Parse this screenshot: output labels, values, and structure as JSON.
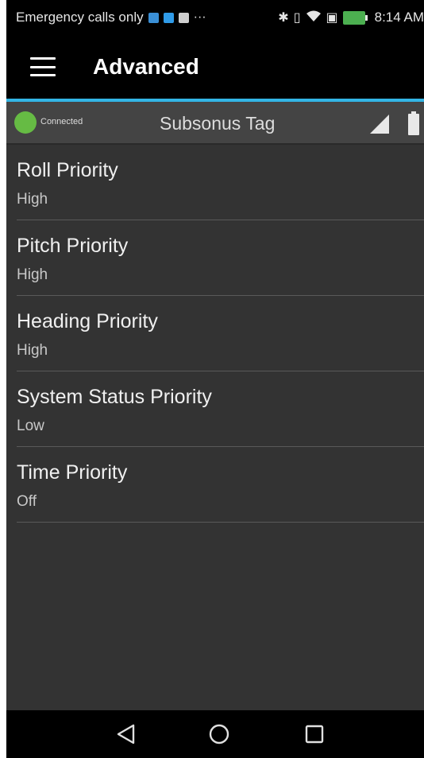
{
  "status_bar": {
    "carrier_text": "Emergency calls only",
    "ellipsis": "···",
    "time": "8:14 AM",
    "icons": [
      "notification-icon",
      "notification-icon",
      "notification-icon",
      "bluetooth-icon",
      "vibrate-icon",
      "wifi-icon",
      "nfc-icon",
      "battery-charging-icon"
    ]
  },
  "app_bar": {
    "title": "Advanced"
  },
  "device": {
    "connection_status": "Connected",
    "name": "Subsonus Tag",
    "status_color": "#66bb44"
  },
  "settings": [
    {
      "title": "Roll Priority",
      "value": "High"
    },
    {
      "title": "Pitch Priority",
      "value": "High"
    },
    {
      "title": "Heading Priority",
      "value": "High"
    },
    {
      "title": "System Status Priority",
      "value": "Low"
    },
    {
      "title": "Time Priority",
      "value": "Off"
    }
  ],
  "colors": {
    "accent": "#33b5e5",
    "list_background": "#333333",
    "header_background": "#444444"
  }
}
